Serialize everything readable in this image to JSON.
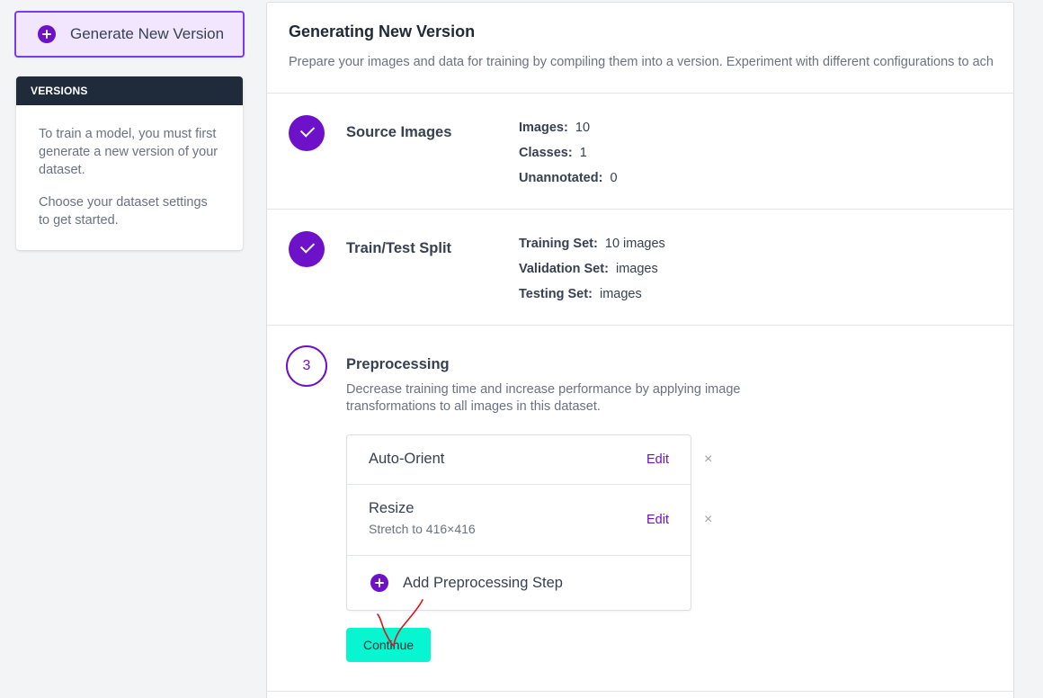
{
  "sidebar": {
    "generate_label": "Generate New Version",
    "versions_title": "VERSIONS",
    "versions_text_1": "To train a model, you must first generate a new version of your dataset.",
    "versions_text_2": "Choose your dataset settings to get started."
  },
  "main": {
    "title": "Generating New Version",
    "subtitle": "Prepare your images and data for training by compiling them into a version. Experiment with different configurations to ach"
  },
  "source_images": {
    "title": "Source Images",
    "stats": [
      {
        "label": "Images:",
        "value": "10"
      },
      {
        "label": "Classes:",
        "value": "1"
      },
      {
        "label": "Unannotated:",
        "value": "0"
      }
    ]
  },
  "split": {
    "title": "Train/Test Split",
    "stats": [
      {
        "label": "Training Set:",
        "value": "10 images"
      },
      {
        "label": "Validation Set:",
        "value": "images"
      },
      {
        "label": "Testing Set:",
        "value": "images"
      }
    ]
  },
  "preprocessing": {
    "number": "3",
    "title": "Preprocessing",
    "description": "Decrease training time and increase performance by applying image transformations to all images in this dataset.",
    "steps": [
      {
        "name": "Auto-Orient",
        "detail": "",
        "edit": "Edit",
        "remove": "×"
      },
      {
        "name": "Resize",
        "detail": "Stretch to 416×416",
        "edit": "Edit",
        "remove": "×"
      }
    ],
    "add_label": "Add Preprocessing Step",
    "continue_label": "Continue"
  },
  "colors": {
    "accent": "#6d12c9",
    "continue_bg": "#07f5d1",
    "annotation": "#e0121c"
  }
}
